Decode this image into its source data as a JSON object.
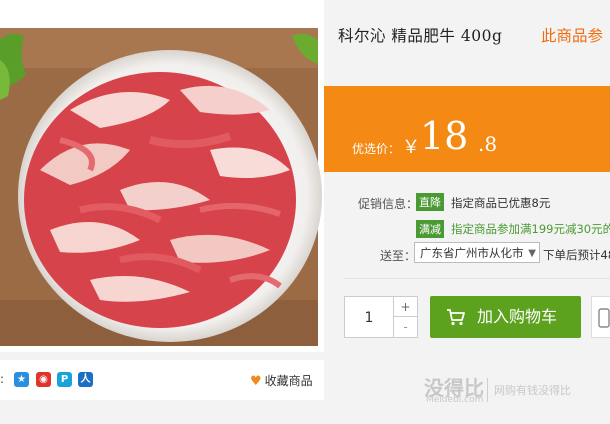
{
  "product": {
    "title": "科尔沁 精品肥牛 400g",
    "title_promo": "此商品参"
  },
  "price": {
    "label": "优选价：",
    "currency": "￥",
    "integer": "18",
    "decimal": ".8"
  },
  "promotion": {
    "label": "促销信息：",
    "items": [
      {
        "tag": "直降",
        "text": "指定商品已优惠8元"
      },
      {
        "tag": "满减",
        "text": "指定商品参加满199元减30元的"
      }
    ]
  },
  "shipping": {
    "label": "送至：",
    "region": "广东省广州市从化市",
    "note": "下单后预计48"
  },
  "cart": {
    "quantity": "1",
    "plus": "+",
    "minus": "-",
    "add_label": "加入购物车"
  },
  "share": {
    "colon": ":",
    "icons": [
      "qzone-icon",
      "weibo-icon",
      "pengyou-icon",
      "renren-icon"
    ],
    "favorite_label": "收藏商品"
  },
  "watermark": {
    "logo": "没得比",
    "sub": "Meidebi.com",
    "slogan": "网购有钱没得比"
  },
  "colors": {
    "price_band": "#f48a14",
    "cart_button": "#5ca21f",
    "tag": "#4a9a33",
    "promo_title": "#f26b10"
  }
}
